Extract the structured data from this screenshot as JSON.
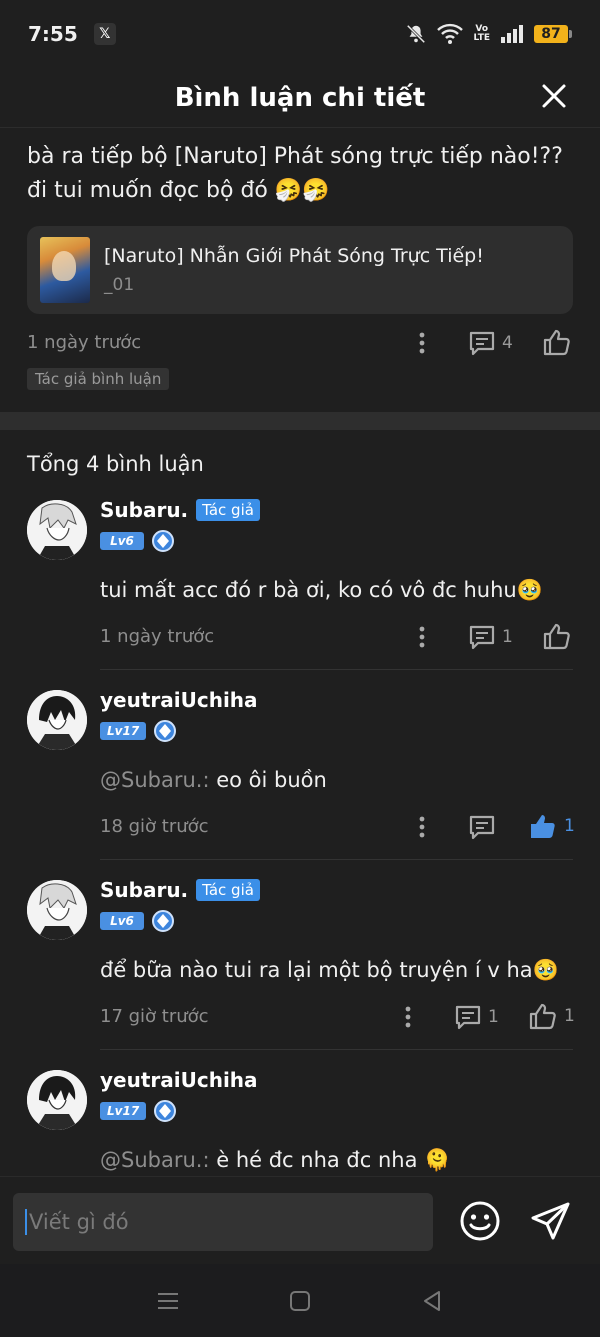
{
  "status_bar": {
    "time": "7:55",
    "app_icon": "x-icon",
    "battery": "87",
    "network_label_top": "Vo",
    "network_label_bottom": "LTE"
  },
  "header": {
    "title": "Bình luận chi tiết"
  },
  "main_comment": {
    "text": "bà ra tiếp bộ [Naruto] Phát sóng trực tiếp nào!?? đi tui muốn đọc bộ đó 🤧🤧",
    "book": {
      "title": "[Naruto] Nhẫn Giới Phát Sóng Trực Tiếp!",
      "subtitle": "_01"
    },
    "time": "1 ngày trước",
    "reply_count": "4",
    "tag": "Tác giả bình luận"
  },
  "total_label": "Tổng 4 bình luận",
  "replies": [
    {
      "name": "Subaru.",
      "author_badge": "Tác giả",
      "level": "Lv6",
      "mention": "",
      "text": "tui mất acc đó r bà ơi, ko có vô đc huhu🥹",
      "time": "1 ngày trước",
      "reply_count": "1",
      "like_count": "",
      "liked": false
    },
    {
      "name": "yeutraiUchiha",
      "author_badge": "",
      "level": "Lv17",
      "mention": "@Subaru.:",
      "text": " eo ôi buồn",
      "time": "18 giờ trước",
      "reply_count": "",
      "like_count": "1",
      "liked": true
    },
    {
      "name": "Subaru.",
      "author_badge": "Tác giả",
      "level": "Lv6",
      "mention": "",
      "text": "để bữa nào tui ra lại một bộ truyện í v ha🥹",
      "time": "17 giờ trước",
      "reply_count": "1",
      "like_count": "1",
      "liked": false
    },
    {
      "name": "yeutraiUchiha",
      "author_badge": "",
      "level": "Lv17",
      "mention": "@Subaru.:",
      "text": " è hé đc nha đc nha 🫠",
      "time": "",
      "reply_count": "",
      "like_count": "",
      "liked": false
    }
  ],
  "composer": {
    "placeholder": "Viết gì đó"
  },
  "colors": {
    "background": "#1f1f1f",
    "accent": "#3b8fe8",
    "liked": "#4a90e2",
    "battery": "#f2b21b"
  }
}
